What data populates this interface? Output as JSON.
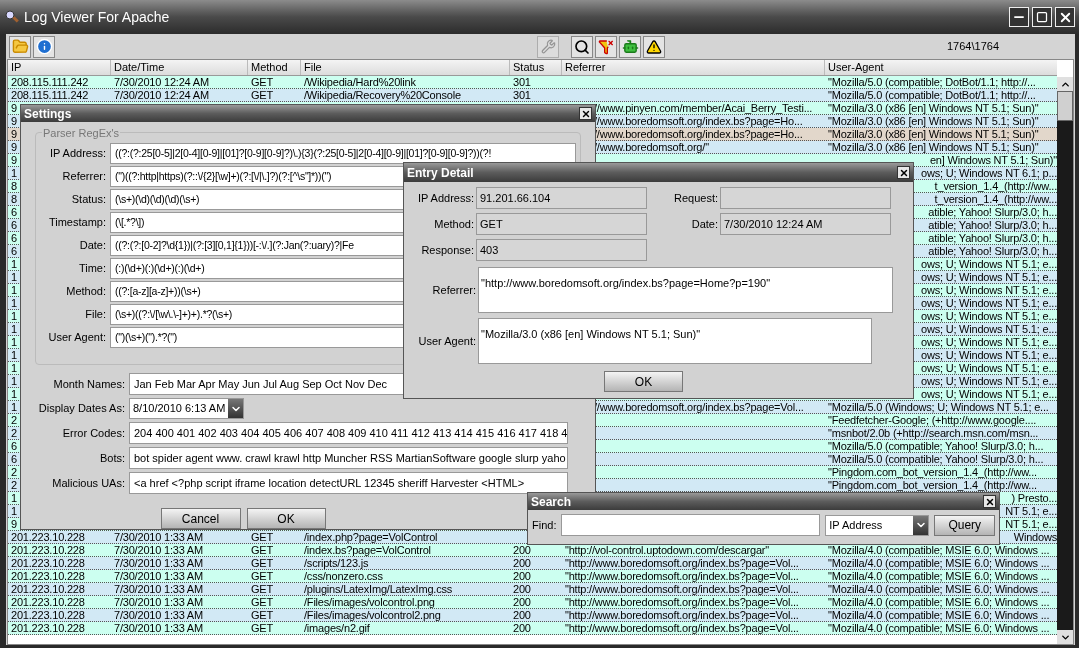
{
  "window": {
    "title": "Log Viewer For Apache"
  },
  "toolbar": {
    "left": [
      {
        "kind": "open",
        "disabled": false
      },
      {
        "kind": "info",
        "disabled": false
      }
    ],
    "right": [
      {
        "kind": "settings",
        "disabled": true
      },
      {
        "kind": "search",
        "disabled": false
      },
      {
        "kind": "filter",
        "disabled": false
      },
      {
        "kind": "bots",
        "disabled": false
      },
      {
        "kind": "warning",
        "disabled": false
      }
    ],
    "count": "1764\\1764"
  },
  "table": {
    "columns": [
      "IP",
      "Date/Time",
      "Method",
      "File",
      "Status",
      "Referrer",
      "User-Agent"
    ],
    "rows": [
      {
        "kind": "full",
        "selected": false,
        "ip": "208.115.111.242",
        "datetime": "7/30/2010 12:24 AM",
        "method": "GET",
        "file": "/Wikipedia/Hard%20link",
        "status": "301",
        "user_agent": "\"Mozilla/5.0 (compatible; DotBot/1.1; http://..."
      },
      {
        "kind": "full",
        "selected": false,
        "ip": "208.115.111.242",
        "datetime": "7/30/2010 12:24 AM",
        "method": "GET",
        "file": "/Wikipedia/Recovery%20Console",
        "status": "301",
        "user_agent": "\"Mozilla/5.0 (compatible; DotBot/1.1; http://..."
      },
      {
        "kind": "settings",
        "selected": false,
        "ip": "9",
        "referrer": "//www.pinyen.com/member/Acai_Berry_Testi...",
        "user_agent": "\"Mozilla/3.0 (x86 [en] Windows NT 5.1; Sun)\""
      },
      {
        "kind": "settings",
        "selected": false,
        "ip": "9",
        "referrer": "//www.boredomsoft.org/index.bs?page=Ho...",
        "user_agent": "\"Mozilla/3.0 (x86 [en] Windows NT 5.1; Sun)\""
      },
      {
        "kind": "settings",
        "selected": true,
        "ip": "9",
        "referrer": "//www.boredomsoft.org/index.bs?page=Ho...",
        "user_agent": "\"Mozilla/3.0 (x86 [en] Windows NT 5.1; Sun)\""
      },
      {
        "kind": "settings",
        "selected": false,
        "ip": "9",
        "referrer": "//www.boredomsoft.org/\"",
        "user_agent": "\"Mozilla/3.0 (x86 [en] Windows NT 5.1; Sun)\""
      },
      {
        "kind": "both",
        "selected": false,
        "ip": "9",
        "user_agent": "en] Windows NT 5.1; Sun)\""
      },
      {
        "kind": "both",
        "selected": false,
        "ip": "1",
        "user_agent": "ows; U; Windows NT 6.1; p..."
      },
      {
        "kind": "both",
        "selected": false,
        "ip": "8",
        "user_agent": "t_version_1.4_(http://ww..."
      },
      {
        "kind": "both",
        "selected": false,
        "ip": "8",
        "user_agent": "t_version_1.4_(http://ww..."
      },
      {
        "kind": "both",
        "selected": false,
        "ip": "6",
        "user_agent": "atible; Yahoo! Slurp/3.0; h..."
      },
      {
        "kind": "both",
        "selected": false,
        "ip": "6",
        "user_agent": "atible; Yahoo! Slurp/3.0; h..."
      },
      {
        "kind": "both",
        "selected": false,
        "ip": "6",
        "user_agent": "atible; Yahoo! Slurp/3.0; h..."
      },
      {
        "kind": "both",
        "selected": false,
        "ip": "6",
        "user_agent": "atible; Yahoo! Slurp/3.0; h..."
      },
      {
        "kind": "both",
        "selected": false,
        "ip": "1",
        "user_agent": "ows; U; Windows NT 5.1; e..."
      },
      {
        "kind": "both",
        "selected": false,
        "ip": "1",
        "user_agent": "ows; U; Windows NT 5.1; e..."
      },
      {
        "kind": "both",
        "selected": false,
        "ip": "1",
        "user_agent": "ows; U; Windows NT 5.1; e..."
      },
      {
        "kind": "both",
        "selected": false,
        "ip": "1",
        "user_agent": "ows; U; Windows NT 5.1; e..."
      },
      {
        "kind": "both",
        "selected": false,
        "ip": "1",
        "user_agent": "ows; U; Windows NT 5.1; e..."
      },
      {
        "kind": "both",
        "selected": false,
        "ip": "1",
        "user_agent": "ows; U; Windows NT 5.1; e..."
      },
      {
        "kind": "both",
        "selected": false,
        "ip": "1",
        "user_agent": "ows; U; Windows NT 5.1; e..."
      },
      {
        "kind": "both",
        "selected": false,
        "ip": "1",
        "user_agent": "ows; U; Windows NT 5.1; e..."
      },
      {
        "kind": "both",
        "selected": false,
        "ip": "1",
        "user_agent": "ows; U; Windows NT 5.1; e..."
      },
      {
        "kind": "both",
        "selected": false,
        "ip": "1",
        "user_agent": "ows; U; Windows NT 5.1; e..."
      },
      {
        "kind": "both",
        "selected": false,
        "ip": "1",
        "user_agent": "ows; U; Windows NT 5.1; e..."
      },
      {
        "kind": "settings",
        "selected": false,
        "ip": "1",
        "referrer": "//www.boredomsoft.org/index.bs?page=Vol...",
        "user_agent": "\"Mozilla/5.0 (Windows; U; Windows NT 5.1; e..."
      },
      {
        "kind": "settings",
        "selected": false,
        "ip": "2",
        "user_agent": "\"Feedfetcher-Google; (+http://www.google...."
      },
      {
        "kind": "settings",
        "selected": false,
        "ip": "2",
        "user_agent": "\"msnbot/2.0b (+http://search.msn.com/msn..."
      },
      {
        "kind": "settings",
        "selected": false,
        "ip": "6",
        "user_agent": "\"Mozilla/5.0 (compatible; Yahoo! Slurp/3.0; h..."
      },
      {
        "kind": "settings",
        "selected": false,
        "ip": "6",
        "user_agent": "\"Mozilla/5.0 (compatible; Yahoo! Slurp/3.0; h..."
      },
      {
        "kind": "settings",
        "selected": false,
        "ip": "2",
        "user_agent": "\"Pingdom.com_bot_version_1.4_(http://ww..."
      },
      {
        "kind": "settings",
        "selected": false,
        "ip": "2",
        "user_agent": "\"Pingdom.com_bot_version_1.4_(http://ww..."
      },
      {
        "kind": "search",
        "selected": false,
        "ip": "1",
        "user_agent": ") Presto..."
      },
      {
        "kind": "search",
        "selected": false,
        "ip": "1",
        "user_agent": "NT 5.1; e..."
      },
      {
        "kind": "search",
        "selected": false,
        "ip": "9",
        "user_agent": "NT 5.1; e..."
      },
      {
        "kind": "search",
        "selected": false,
        "ip": "201.223.10.228",
        "datetime": "7/30/2010 1:33 AM",
        "method": "GET",
        "file": "/index.php?page=VolControl",
        "user_agent": "Windows"
      },
      {
        "kind": "full",
        "selected": false,
        "ip": "201.223.10.228",
        "datetime": "7/30/2010 1:33 AM",
        "method": "GET",
        "file": "/index.bs?page=VolControl",
        "status": "200",
        "referrer": "\"http://vol-control.uptodown.com/descargar\"",
        "user_agent": "\"Mozilla/4.0 (compatible; MSIE 6.0; Windows ..."
      },
      {
        "kind": "full",
        "selected": false,
        "ip": "201.223.10.228",
        "datetime": "7/30/2010 1:33 AM",
        "method": "GET",
        "file": "/scripts/123.js",
        "status": "200",
        "referrer": "\"http://www.boredomsoft.org/index.bs?page=Vol...",
        "user_agent": "\"Mozilla/4.0 (compatible; MSIE 6.0; Windows ..."
      },
      {
        "kind": "full",
        "selected": false,
        "ip": "201.223.10.228",
        "datetime": "7/30/2010 1:33 AM",
        "method": "GET",
        "file": "/css/nonzero.css",
        "status": "200",
        "referrer": "\"http://www.boredomsoft.org/index.bs?page=Vol...",
        "user_agent": "\"Mozilla/4.0 (compatible; MSIE 6.0; Windows ..."
      },
      {
        "kind": "full",
        "selected": false,
        "ip": "201.223.10.228",
        "datetime": "7/30/2010 1:33 AM",
        "method": "GET",
        "file": "/plugins/LatexImg/LatexImg.css",
        "status": "200",
        "referrer": "\"http://www.boredomsoft.org/index.bs?page=Vol...",
        "user_agent": "\"Mozilla/4.0 (compatible; MSIE 6.0; Windows ..."
      },
      {
        "kind": "full",
        "selected": false,
        "ip": "201.223.10.228",
        "datetime": "7/30/2010 1:33 AM",
        "method": "GET",
        "file": "/Files/images/volcontrol.png",
        "status": "200",
        "referrer": "\"http://www.boredomsoft.org/index.bs?page=Vol...",
        "user_agent": "\"Mozilla/4.0 (compatible; MSIE 6.0; Windows ..."
      },
      {
        "kind": "full",
        "selected": false,
        "ip": "201.223.10.228",
        "datetime": "7/30/2010 1:33 AM",
        "method": "GET",
        "file": "/Files/images/volcontrol2.png",
        "status": "200",
        "referrer": "\"http://www.boredomsoft.org/index.bs?page=Vol...",
        "user_agent": "\"Mozilla/4.0 (compatible; MSIE 6.0; Windows ..."
      },
      {
        "kind": "full",
        "selected": false,
        "ip": "201.223.10.228",
        "datetime": "7/30/2010 1:33 AM",
        "method": "GET",
        "file": "/images/n2.gif",
        "status": "200",
        "referrer": "\"http://www.boredomsoft.org/index.bs?page=Vol...",
        "user_agent": "\"Mozilla/4.0 (compatible; MSIE 6.0; Windows ..."
      }
    ]
  },
  "settings": {
    "title": "Settings",
    "group_title": "Parser RegEx's",
    "parser_fields": [
      {
        "label": "IP Address:",
        "value": "((?:(?:25[0-5]|2[0-4][0-9]|[01]?[0-9][0-9]?)\\.){3}(?:25[0-5]|2[0-4][0-9]|[01]?[0-9][0-9]?))(?!"
      },
      {
        "label": "Referrer:",
        "value": "(\")((?:http|https)(?::\\/{2}[\\w]+)(?:[\\/|\\.]?)(?:[^\\s\"]*))(\")"
      },
      {
        "label": "Status:",
        "value": "(\\s+)(\\d)(\\d)(\\d)(\\s+)"
      },
      {
        "label": "Timestamp:",
        "value": "(\\[.*?\\])"
      },
      {
        "label": "Date:",
        "value": "((?:(?:[0-2]?\\d{1})|(?:[3][0,1]{1}))[-:\\/.](?:Jan(?:uary)?|Fe"
      },
      {
        "label": "Time:",
        "value": "(:)(\\d+)(:)(\\d+)(:)(\\d+)"
      },
      {
        "label": "Method:",
        "value": "((?:[a-z][a-z]+))(\\s+)"
      },
      {
        "label": "File:",
        "value": "(\\s+)((?:\\/[\\w\\.\\-]+)+).*?(\\s+)"
      },
      {
        "label": "User Agent:",
        "value": "(\")(\\s+)(\").*?(\")"
      }
    ],
    "other_fields": [
      {
        "kind": "text",
        "label": "Month Names:",
        "value": "Jan Feb Mar Apr May Jun Jul Aug Sep Oct Nov Dec"
      },
      {
        "kind": "dropdown",
        "label": "Display Dates As:",
        "value": "8/10/2010 6:13 AM"
      },
      {
        "kind": "text",
        "label": "Error Codes:",
        "value": "204 400 401 402 403 404 405 406 407 408 409 410 411 412 413 414 415 416 417 418 4"
      },
      {
        "kind": "text",
        "label": "Bots:",
        "value": "bot spider agent www. crawl krawl http Muncher RSS MartianSoftware google slurp yaho"
      },
      {
        "kind": "text",
        "label": "Malicious UAs:",
        "value": "<a href <?php script iframe location detectURL 12345 sheriff Harvester <HTML>"
      }
    ],
    "buttons": [
      "Cancel",
      "OK"
    ]
  },
  "entry_detail": {
    "title": "Entry Detail",
    "left_fields": [
      {
        "label": "IP Address:",
        "value": "91.201.66.104"
      },
      {
        "label": "Method:",
        "value": "GET"
      },
      {
        "label": "Response:",
        "value": "403"
      }
    ],
    "right_fields": [
      {
        "label": "Request:"
      },
      {
        "label": "Date:",
        "value": "7/30/2010 12:24 AM"
      }
    ],
    "referrer": {
      "label": "Referrer:",
      "value": "\"http://www.boredomsoft.org/index.bs?page=Home?p=190\""
    },
    "user_agent": {
      "label": "User Agent:",
      "value": "\"Mozilla/3.0 (x86 [en] Windows NT 5.1; Sun)\""
    },
    "button": "OK"
  },
  "search": {
    "title": "Search",
    "find_label": "Find:",
    "field": "IP Address",
    "button": "Query"
  }
}
